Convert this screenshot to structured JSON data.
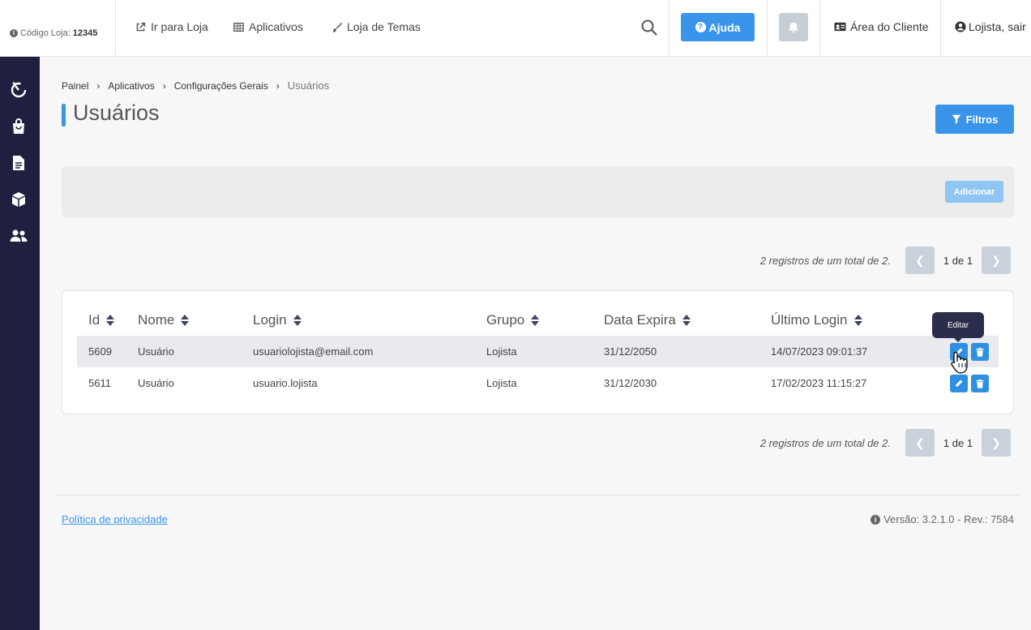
{
  "topbar": {
    "store_code_label": "Código Loja:",
    "store_code_value": "12345",
    "links": [
      "Ir para Loja",
      "Aplicativos",
      "Loja de Temas"
    ],
    "help_label": "Ajuda",
    "client_area_label": "Área do Cliente",
    "user_label": "Lojista, sair"
  },
  "sidebar": {
    "icons": [
      "dashboard-gauge-icon",
      "shopping-bag-icon",
      "document-icon",
      "box-icon",
      "users-icon"
    ]
  },
  "breadcrumb": {
    "items": [
      "Painel",
      "Aplicativos",
      "Configurações Gerais"
    ],
    "current": "Usuários"
  },
  "page": {
    "title": "Usuários",
    "filter_label": "Filtros",
    "add_label": "Adicionar"
  },
  "pagination": {
    "info": "2 registros de um total de 2.",
    "pages": "1 de 1"
  },
  "table": {
    "columns": [
      "Id",
      "Nome",
      "Login",
      "Grupo",
      "Data Expira",
      "Último Login"
    ],
    "rows": [
      {
        "id": "5609",
        "nome": "Usuário",
        "login": "usuariolojista@email.com",
        "grupo": "Lojista",
        "data_expira": "31/12/2050",
        "ultimo_login": "14/07/2023 09:01:37"
      },
      {
        "id": "5611",
        "nome": "Usuário",
        "login": "usuario.lojista",
        "grupo": "Lojista",
        "data_expira": "31/12/2030",
        "ultimo_login": "17/02/2023 11:15:27"
      }
    ],
    "tooltip": "Editar"
  },
  "footer": {
    "privacy": "Política de privacidade",
    "version": "Versão: 3.2.1.0 - Rev.: 7584"
  },
  "colors": {
    "primary": "#3a95ea",
    "sidebar": "#1f2040"
  }
}
